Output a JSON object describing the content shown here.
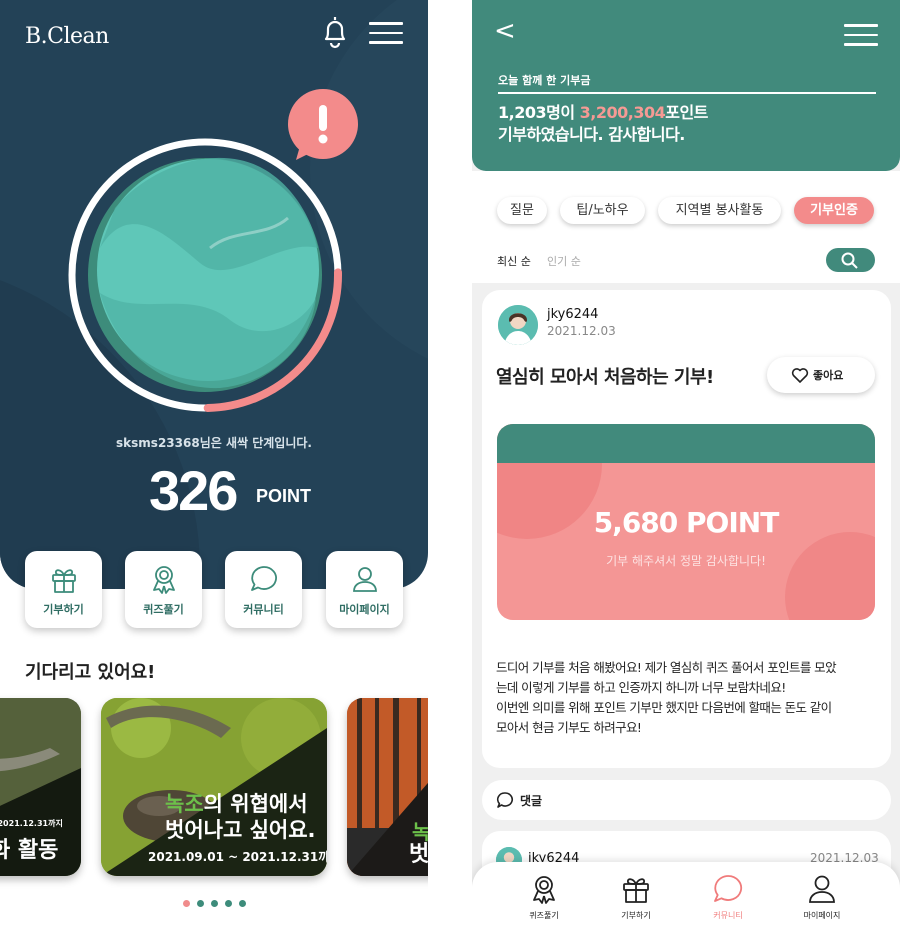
{
  "left": {
    "logo": "B.Clean",
    "status_text": "sksms23368님은 새싹 단계입니다.",
    "points": "326",
    "points_unit": "POINT",
    "progress_fraction": 0.25,
    "quick_menu": [
      "기부하기",
      "퀴즈풀기",
      "커뮤니티",
      "마이페이지"
    ],
    "section_title": "기다리고 있어요!",
    "cards": [
      {
        "date": "~ 2021.12.31까지",
        "title": "화 활동"
      },
      {
        "title_highlight": "녹조",
        "title_rest": "의 위협에서",
        "title_line2": "벗어나고 싶어요.",
        "date": "2021.09.01 ~ 2021.12.31까지"
      },
      {
        "title_highlight": "녹",
        "title_line2": "벗"
      }
    ],
    "pagination": {
      "total": 5,
      "active": 0
    }
  },
  "right": {
    "back_label": "<",
    "donation_title": "오늘 함께 한 기부금",
    "donation_count": "1,203명이 ",
    "donation_points": "3,200,304",
    "donation_suffix": "포인트",
    "donation_line2": "기부하였습니다. 감사합니다.",
    "tabs": [
      "질문",
      "팁/노하우",
      "지역별 봉사활동",
      "기부인증"
    ],
    "active_tab": "기부인증",
    "sort_options": [
      "최신 순",
      "인기 순"
    ],
    "post": {
      "username": "jky6244",
      "date": "2021.12.03",
      "title": "열심히 모아서 처음하는 기부!",
      "like_label": "좋아요",
      "point_amount": "5,680 POINT",
      "thanks_text": "기부 해주셔서 정말 감사합니다!",
      "body": [
        "드디어 기부를 처음 해봤어요! 제가 열심히 퀴즈 풀어서 포인트를 모았",
        "는데 이렇게 기부를 하고 인증까지 하니까 너무 보람차네요!",
        "이번엔 의미를 위해 포인트 기부만 했지만 다음번에 할때는 돈도 같이",
        "모아서 현금 기부도 하려구요!"
      ]
    },
    "comment_label": "댓글",
    "post2": {
      "username": "jky6244",
      "date": "2021.12.03"
    },
    "tabbar": [
      "퀴즈풀기",
      "기부하기",
      "커뮤니티",
      "마이페이지"
    ],
    "active_tabbar": "커뮤니티"
  },
  "colors": {
    "navy": "#234257",
    "teal": "#418a7c",
    "globe": "#5fc7b8",
    "coral": "#f38b8b",
    "green_highlight": "#6cc04a"
  }
}
